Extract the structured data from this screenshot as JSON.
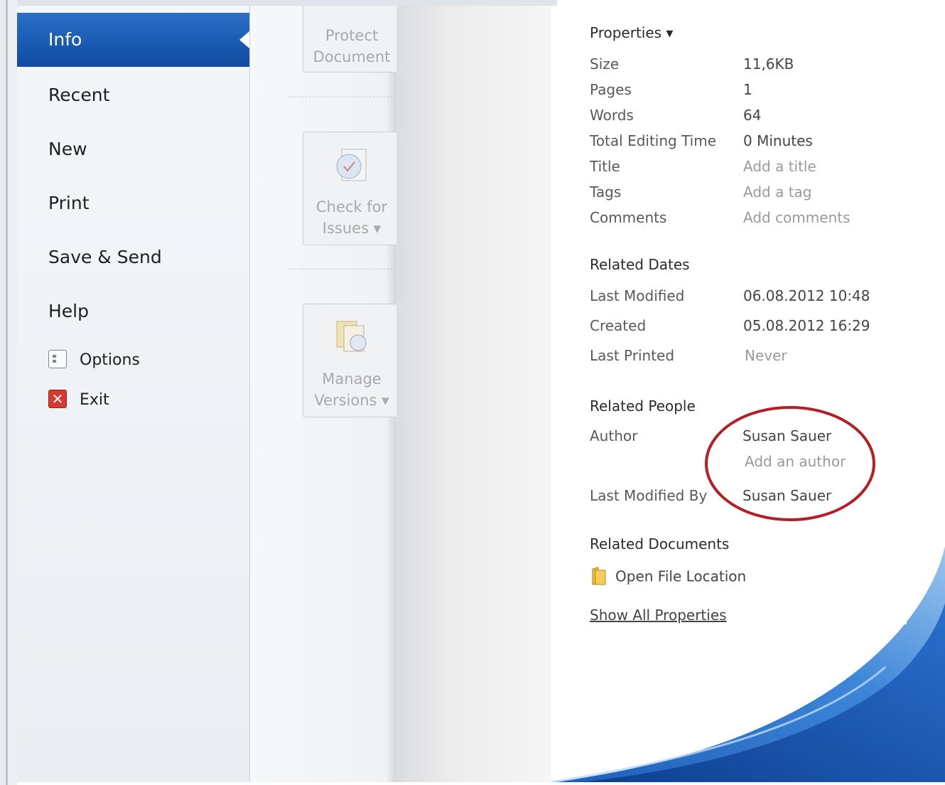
{
  "nav": {
    "items": [
      {
        "label": "Info"
      },
      {
        "label": "Recent"
      },
      {
        "label": "New"
      },
      {
        "label": "Print"
      },
      {
        "label": "Save & Send"
      },
      {
        "label": "Help"
      }
    ],
    "options_label": "Options",
    "exit_label": "Exit"
  },
  "middle": {
    "protect": {
      "line1": "Protect",
      "line2": "Document"
    },
    "check": {
      "line1": "Check for",
      "line2": "Issues ▾"
    },
    "versions": {
      "line1": "Manage",
      "line2": "Versions ▾"
    }
  },
  "properties": {
    "header": "Properties ▾",
    "rows": [
      {
        "label": "Size",
        "value": "11,6KB"
      },
      {
        "label": "Pages",
        "value": "1"
      },
      {
        "label": "Words",
        "value": "64"
      },
      {
        "label": "Total Editing Time",
        "value": "0 Minutes"
      },
      {
        "label": "Title",
        "value": "Add a title"
      },
      {
        "label": "Tags",
        "value": "Add a tag"
      },
      {
        "label": "Comments",
        "value": "Add comments"
      }
    ]
  },
  "related_dates": {
    "header": "Related Dates",
    "rows": [
      {
        "label": "Last Modified",
        "value": "06.08.2012 10:48"
      },
      {
        "label": "Created",
        "value": "05.08.2012 16:29"
      },
      {
        "label": "Last Printed",
        "value": "Never"
      }
    ]
  },
  "related_people": {
    "header": "Related People",
    "author_label": "Author",
    "author_value": "Susan Sauer",
    "add_author": "Add an author",
    "modified_by_label": "Last Modified By",
    "modified_by_value": "Susan Sauer"
  },
  "related_documents": {
    "header": "Related Documents",
    "open_location": "Open File Location",
    "show_all": "Show All Properties"
  },
  "colors": {
    "accent": "#1a5bb3",
    "highlight_circle": "#b31f24"
  }
}
